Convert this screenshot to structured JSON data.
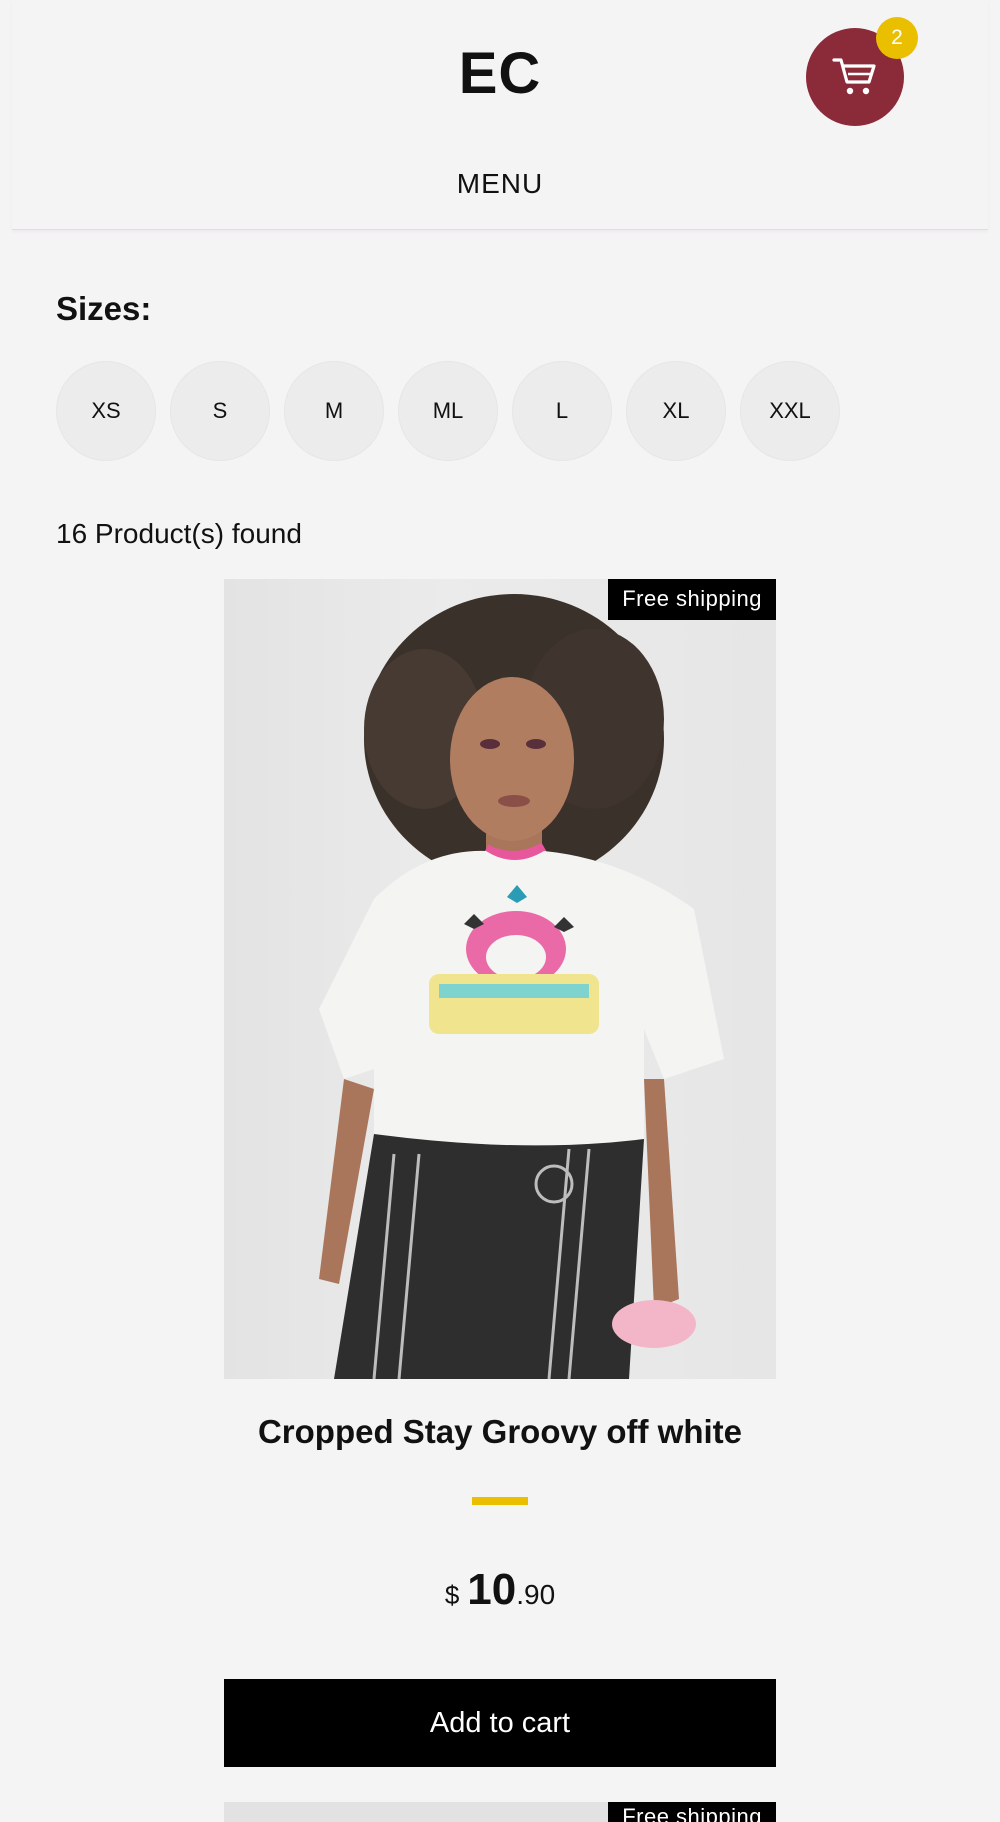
{
  "header": {
    "logo": "EC",
    "menu_label": "MENU",
    "cart_count": "2",
    "cart_icon": "cart-icon",
    "cart_color": "#8b2a39",
    "badge_color": "#eabf00"
  },
  "filters": {
    "title": "Sizes:",
    "sizes": [
      "XS",
      "S",
      "M",
      "ML",
      "L",
      "XL",
      "XXL"
    ]
  },
  "results": {
    "found_text": "16 Product(s) found"
  },
  "products": [
    {
      "badge": "Free shipping",
      "title": "Cropped Stay Groovy off white",
      "currency": "$",
      "price_int": "10",
      "price_cents": ".90",
      "button_label": "Add to cart"
    },
    {
      "badge": "Free shipping"
    }
  ]
}
